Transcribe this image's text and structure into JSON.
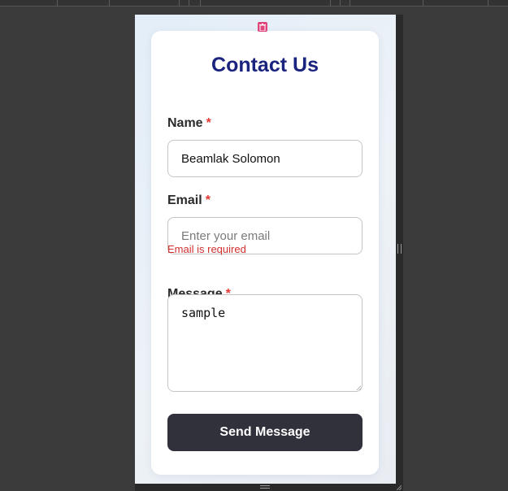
{
  "form": {
    "title": "Contact Us",
    "required_marker": "*",
    "name": {
      "label": "Name",
      "value": "Beamlak Solomon",
      "placeholder": ""
    },
    "email": {
      "label": "Email",
      "value": "",
      "placeholder": "Enter your email",
      "error": "Email is required"
    },
    "message": {
      "label": "Message",
      "value": "sample"
    },
    "submit_label": "Send Message"
  },
  "colors": {
    "title": "#1a237e",
    "required": "#e53935",
    "error": "#d32f2f",
    "button": "#30313a",
    "pin_icon": "#e0467c"
  },
  "icons": {
    "pin": "delete-badge-icon",
    "right_handle": "vertical-resize-handle-icon",
    "bottom_handle": "horizontal-resize-handle-icon",
    "corner": "corner-resize-icon"
  }
}
